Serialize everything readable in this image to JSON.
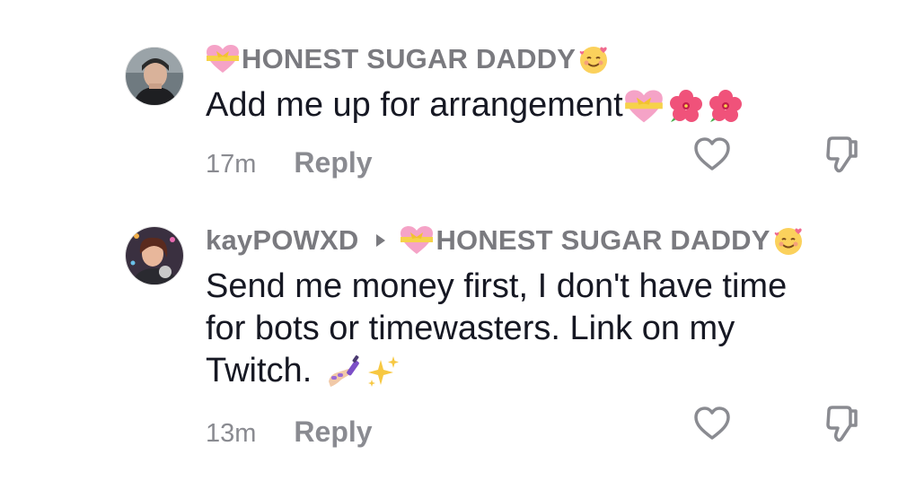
{
  "comments": [
    {
      "author": "HONEST SUGAR DADDY",
      "author_emoji_prefix": "heart-with-ribbon-emoji",
      "author_emoji_suffix": "smiling-face-with-hearts-emoji",
      "text": "Add me up for arrangement",
      "text_emojis": [
        "heart-with-ribbon-emoji",
        "hibiscus-emoji",
        "hibiscus-emoji"
      ],
      "time": "17m",
      "reply_label": "Reply",
      "like_icon": "heart-outline-icon",
      "dislike_icon": "thumbs-down-outline-icon"
    },
    {
      "author": "kayPOWXD",
      "reply_to": "HONEST SUGAR DADDY",
      "reply_to_emoji_prefix": "heart-with-ribbon-emoji",
      "reply_to_emoji_suffix": "smiling-face-with-hearts-emoji",
      "text_lines": [
        "Send me money first, I don't have time",
        "for bots or timewasters. Link on my",
        "Twitch."
      ],
      "text_emojis": [
        "nail-polish-emoji",
        "sparkles-emoji"
      ],
      "time": "13m",
      "reply_label": "Reply",
      "like_icon": "heart-outline-icon",
      "dislike_icon": "thumbs-down-outline-icon"
    }
  ],
  "colors": {
    "username": "#7a7a7f",
    "text": "#161823",
    "meta": "#8a8b91"
  }
}
